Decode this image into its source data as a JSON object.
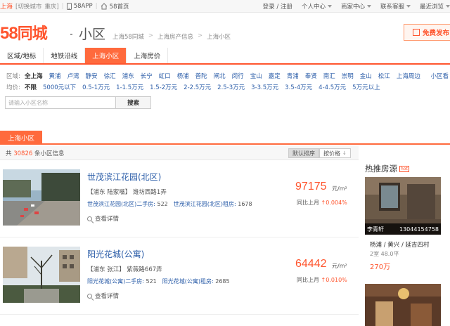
{
  "topbar": {
    "city": "上海",
    "switch_city": "[切换城市",
    "current_city": "重庆]",
    "app_label": "58APP",
    "home_label": "58首页",
    "login": "登录 / 注册",
    "personal_center": "个人中心",
    "merchant_center": "商家中心",
    "customer_service": "联系客服",
    "recent_browse": "最近浏览"
  },
  "header": {
    "logo_num": "58",
    "logo_text": "同城",
    "section_title": "小区",
    "breadcrumb": [
      "上海58同城",
      "上海房产信息",
      "上海小区"
    ],
    "post_button": "免费发布"
  },
  "nav": {
    "tabs": [
      {
        "label": "区域/地标",
        "active": false
      },
      {
        "label": "地铁沿线",
        "active": false
      },
      {
        "label": "上海小区",
        "active": true
      },
      {
        "label": "上海房价",
        "active": false
      }
    ]
  },
  "filters": {
    "district_label": "区域:",
    "districts": [
      "全上海",
      "黄浦",
      "卢湾",
      "静安",
      "徐汇",
      "浦东",
      "长宁",
      "虹口",
      "杨浦",
      "普陀",
      "闸北",
      "闵行",
      "宝山",
      "嘉定",
      "青浦",
      "奉贤",
      "南汇",
      "崇明",
      "金山",
      "松江",
      "上海周边"
    ],
    "district_map_link": "小区看",
    "price_label": "均价:",
    "prices": [
      "不限",
      "5000元以下",
      "0.5-1万元",
      "1-1.5万元",
      "1.5-2万元",
      "2-2.5万元",
      "2.5-3万元",
      "3-3.5万元",
      "3.5-4万元",
      "4-4.5万元",
      "5万元以上"
    ]
  },
  "search": {
    "placeholder": "请输入小区名称",
    "button": "搜索"
  },
  "section": {
    "tab": "上海小区",
    "count_prefix": "共",
    "count": "30826",
    "count_suffix": "条小区信息",
    "sort_default": "默认排序",
    "sort_price": "按价格"
  },
  "listings": [
    {
      "name": "世茂滨江花园(北区)",
      "address": "【浦东 陆家嘴】 潍坊西路1弄",
      "secondhand_label": "世茂滨江花园(北区)二手房:",
      "secondhand_count": "522",
      "rent_label": "世茂滨江花园(北区)租房:",
      "rent_count": "1678",
      "detail": "查看详情",
      "price": "97175",
      "unit": "元/m²",
      "mom_label": "同比上月",
      "mom_pct": "0.004%"
    },
    {
      "name": "阳光花城(公寓)",
      "address": "【浦东 张江】 紫薇路667弄",
      "secondhand_label": "阳光花城(公寓)二手房:",
      "secondhand_count": "521",
      "rent_label": "阳光花城(公寓)租房:",
      "rent_count": "2685",
      "detail": "查看详情",
      "price": "64442",
      "unit": "元/m²",
      "mom_label": "同比上月",
      "mom_pct": "0.010%"
    }
  ],
  "hot": {
    "title": "热推房源",
    "badge": "hot",
    "agent": "李青轩",
    "phone": "13044154758",
    "location": "杨浦 / 黄兴 / 延吉四村",
    "spec": "2室 48.0平",
    "price": "270万"
  },
  "colors": {
    "brand": "#ff552e",
    "link": "#2a5ca8"
  }
}
